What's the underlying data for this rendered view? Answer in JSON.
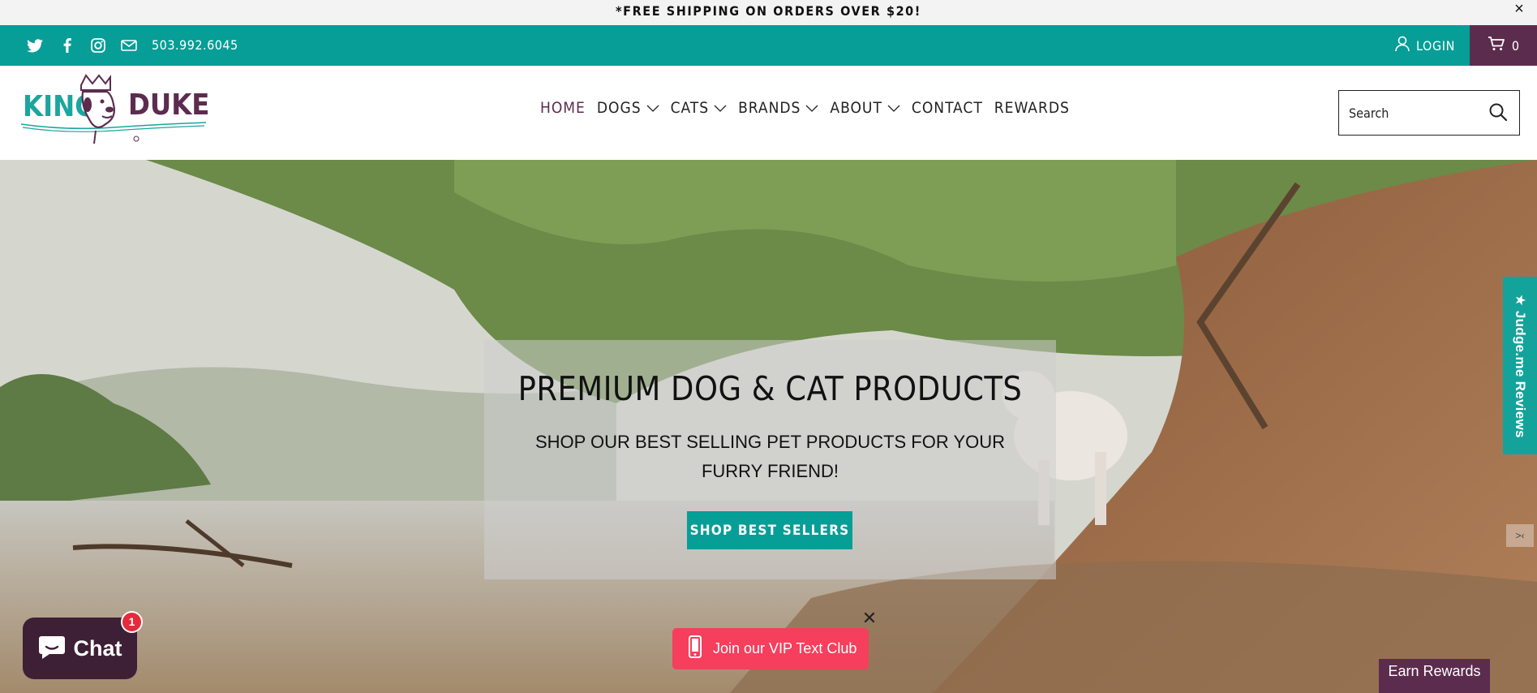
{
  "announcement": {
    "text": "*FREE SHIPPING ON ORDERS OVER $20!",
    "close": "×"
  },
  "topbar": {
    "social": [
      "twitter-icon",
      "facebook-icon",
      "instagram-icon",
      "email-icon"
    ],
    "phone": "503.992.6045",
    "login_label": "LOGIN",
    "cart_count": "0"
  },
  "logo": {
    "text": "KING DUKE'S"
  },
  "nav": {
    "items": [
      {
        "label": "HOME",
        "active": true,
        "dropdown": false
      },
      {
        "label": "DOGS",
        "dropdown": true
      },
      {
        "label": "CATS",
        "dropdown": true
      },
      {
        "label": "BRANDS",
        "dropdown": true
      },
      {
        "label": "ABOUT",
        "dropdown": true
      },
      {
        "label": "CONTACT",
        "dropdown": false
      },
      {
        "label": "REWARDS",
        "dropdown": false
      }
    ]
  },
  "search": {
    "placeholder": "Search"
  },
  "hero": {
    "title": "PREMIUM DOG & CAT PRODUCTS",
    "subtitle": "SHOP OUR BEST SELLING PET PRODUCTS FOR YOUR FURRY FRIEND!",
    "cta_label": "SHOP BEST SELLERS"
  },
  "judge": {
    "label": "★ Judge.me Reviews"
  },
  "chat": {
    "label": "Chat",
    "badge": "1"
  },
  "vip": {
    "label": "Join our VIP Text Club"
  },
  "rewards": {
    "label": "Earn Rewards"
  },
  "colors": {
    "teal": "#069e96",
    "purple": "#5c2c4e",
    "vip_pink": "#f63e5d"
  }
}
